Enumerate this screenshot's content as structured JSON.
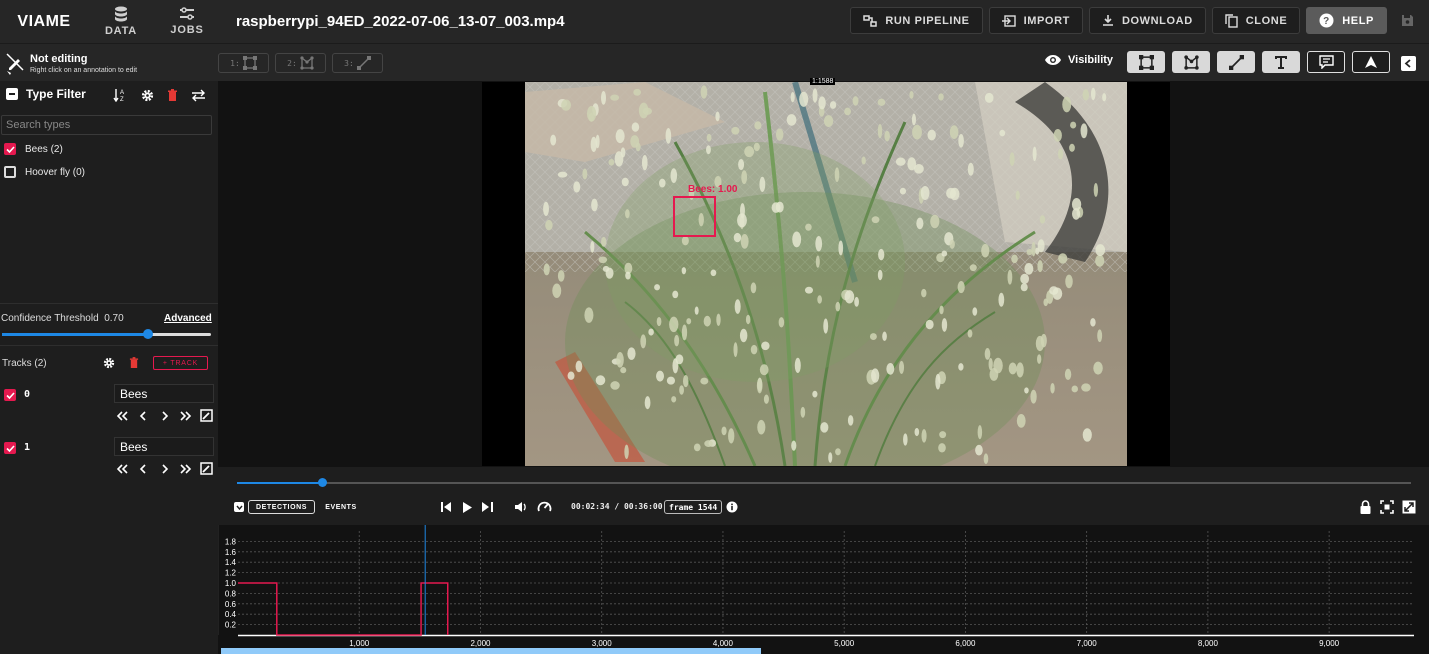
{
  "app": {
    "brand": "VIAME",
    "filename": "raspberrypi_94ED_2022-07-06_13-07_003.mp4"
  },
  "nav": [
    {
      "label": "DATA",
      "icon": "database-icon"
    },
    {
      "label": "JOBS",
      "icon": "jobs-icon"
    }
  ],
  "actions": {
    "run_pipeline": "RUN PIPELINE",
    "import": "IMPORT",
    "download": "DOWNLOAD",
    "clone": "CLONE",
    "help": "HELP"
  },
  "editing": {
    "title": "Not editing",
    "subtitle": "Right click on an annotation to edit"
  },
  "modes": [
    {
      "key": "1:",
      "icon": "rectangle-icon"
    },
    {
      "key": "2:",
      "icon": "polygon-icon"
    },
    {
      "key": "3:",
      "icon": "line-icon"
    }
  ],
  "visibility": {
    "label": "Visibility",
    "buttons": [
      {
        "name": "rectangle-visibility-icon",
        "active": true
      },
      {
        "name": "polygon-visibility-icon",
        "active": true
      },
      {
        "name": "line-visibility-icon",
        "active": true
      },
      {
        "name": "text-visibility-icon",
        "active": true
      },
      {
        "name": "tooltip-visibility-icon",
        "active": false
      },
      {
        "name": "heading-visibility-icon",
        "active": false
      }
    ]
  },
  "type_filter": {
    "title": "Type Filter",
    "search_placeholder": "Search types",
    "types": [
      {
        "label": "Bees (2)",
        "checked": true
      },
      {
        "label": "Hoover fly (0)",
        "checked": false
      }
    ]
  },
  "confidence": {
    "label": "Confidence Threshold",
    "value": "0.70",
    "fraction": 0.7,
    "advanced": "Advanced"
  },
  "tracks": {
    "label": "Tracks (2)",
    "add_label": "+ TRACK",
    "items": [
      {
        "id": "0",
        "type": "Bees",
        "checked": true
      },
      {
        "id": "1",
        "type": "Bees",
        "checked": true
      }
    ]
  },
  "viewer": {
    "annotation_label": "Bees: 1.00",
    "top_label": "1:1588"
  },
  "controls": {
    "detections": "DETECTIONS",
    "events": "EVENTS",
    "time": "00:02:34 / 00:36:00",
    "frame": "frame 1544",
    "playhead_fraction": 0.072
  },
  "chart_data": {
    "type": "line",
    "y_ticks": [
      "1.8",
      "1.6",
      "1.4",
      "1.2",
      "1.0",
      "0.8",
      "0.6",
      "0.4",
      "0.2"
    ],
    "x_ticks": [
      "1,000",
      "2,000",
      "3,000",
      "4,000",
      "5,000",
      "6,000",
      "7,000",
      "8,000",
      "9,000"
    ],
    "xlim": [
      0,
      9700
    ],
    "ylim": [
      0,
      2.0
    ],
    "playhead_frame": 1544,
    "series": [
      {
        "color": "#e5194f",
        "x": [
          0,
          320,
          320,
          1510,
          1510,
          1730,
          1730
        ],
        "y": [
          1.0,
          1.0,
          0,
          0,
          1.0,
          1.0,
          0
        ]
      }
    ],
    "grid": true
  }
}
